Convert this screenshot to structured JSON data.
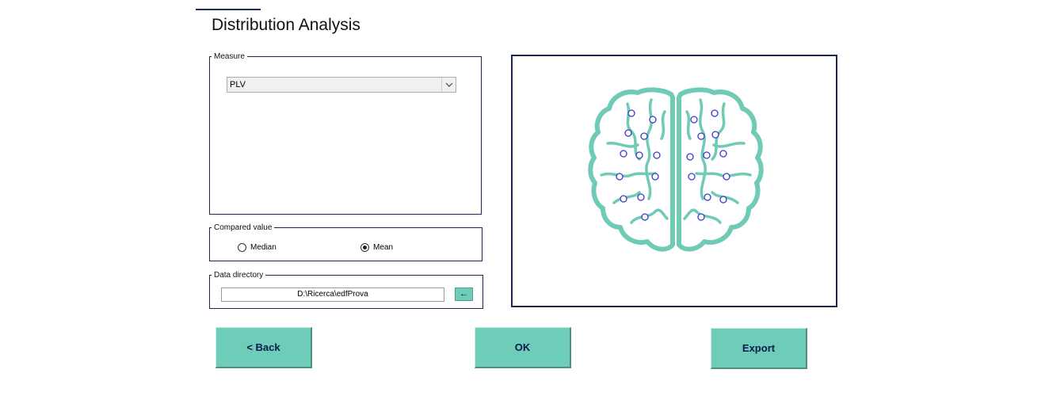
{
  "title": "Distribution Analysis",
  "measure": {
    "legend": "Measure",
    "selected": "PLV"
  },
  "compared": {
    "legend": "Compared value",
    "options": [
      "Median",
      "Mean"
    ],
    "selected": "Mean"
  },
  "data_directory": {
    "legend": "Data directory",
    "path": "D:\\Ricerca\\edfProva",
    "button_label": "←"
  },
  "buttons": {
    "back": "<  Back",
    "ok": "OK",
    "export": "Export"
  },
  "colors": {
    "accent": "#6dcdb8",
    "frame": "#1c2550",
    "brain": "#6fcbb6",
    "electrode": "#3a3ad0"
  },
  "icons": {
    "select_arrow": "chevron-down-icon",
    "brain": "brain-icon",
    "electrode": "electrode-icon"
  }
}
